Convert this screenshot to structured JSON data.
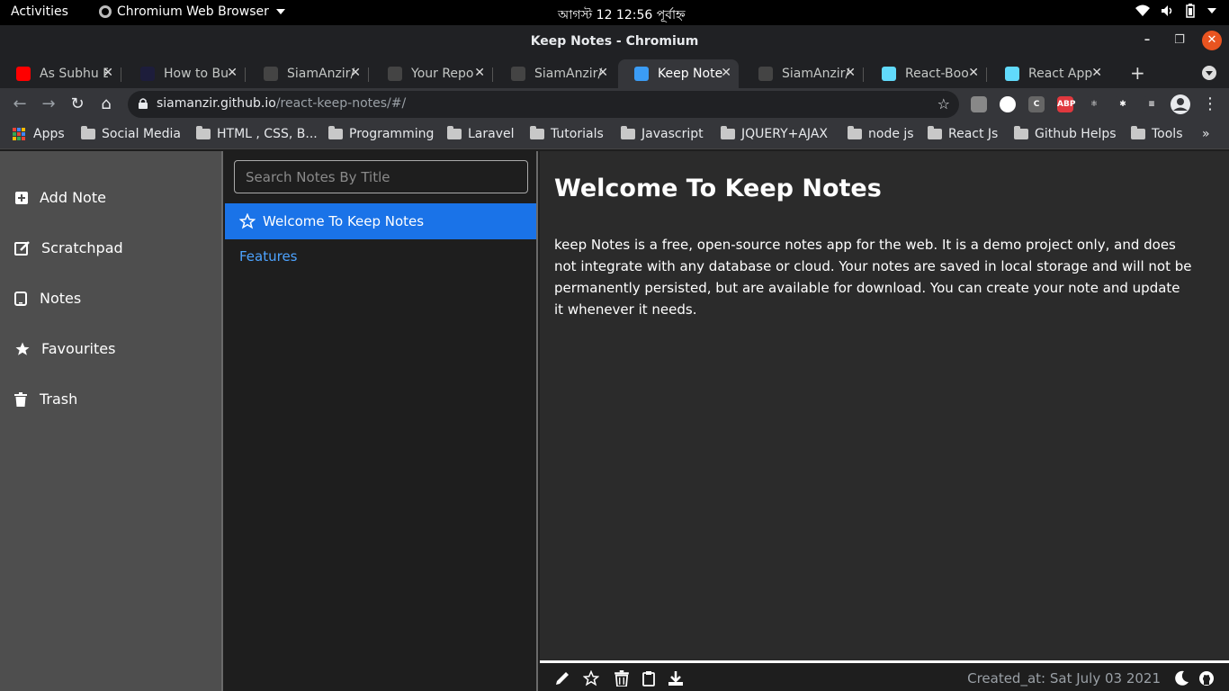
{
  "os_bar": {
    "activities": "Activities",
    "app_name": "Chromium Web Browser",
    "clock": "আগস্ট 12  12:56 পূর্বাহ্ন"
  },
  "window": {
    "title": "Keep Notes - Chromium"
  },
  "tabs": [
    {
      "label": "As Subhu E",
      "color": "#ff0000"
    },
    {
      "label": "How to Bu",
      "color": "#1d1d3b"
    },
    {
      "label": "SiamAnzir/",
      "color": "#444"
    },
    {
      "label": "Your Repo",
      "color": "#444"
    },
    {
      "label": "SiamAnzir/",
      "color": "#444"
    },
    {
      "label": "Keep Note",
      "color": "#3b9cf5"
    },
    {
      "label": "SiamAnzir/",
      "color": "#444"
    },
    {
      "label": "React-Boo",
      "color": "#61dafb"
    },
    {
      "label": "React App",
      "color": "#61dafb"
    }
  ],
  "omnibox": {
    "domain": "siamanzir.github.io",
    "path": "/react-keep-notes/#/"
  },
  "extensions": [
    {
      "name": "copy-extension-icon",
      "text": "",
      "color": "#888"
    },
    {
      "name": "dark-reader-icon",
      "text": "",
      "color": "#fff"
    },
    {
      "name": "cookie-extension-icon",
      "text": "C",
      "color": "#666"
    },
    {
      "name": "adblock-plus-icon",
      "text": "ABP",
      "color": "#e0383e"
    },
    {
      "name": "react-devtools-icon",
      "text": "⚛",
      "color": "#35363a"
    },
    {
      "name": "extensions-puzzle-icon",
      "text": "✱",
      "color": "#35363a"
    },
    {
      "name": "media-control-icon",
      "text": "≡",
      "color": "#35363a"
    }
  ],
  "bookmarks": {
    "apps_label": "Apps",
    "items": [
      "Social Media",
      "HTML , CSS, B...",
      "Programming",
      "Laravel",
      "Tutorials",
      "Javascript",
      "JQUERY+AJAX",
      "node js",
      "React Js",
      "Github Helps",
      "Tools"
    ],
    "more": "»"
  },
  "sidebar": {
    "items": [
      {
        "label": "Add Note",
        "icon": "plus-square-icon"
      },
      {
        "label": "Scratchpad",
        "icon": "edit-icon"
      },
      {
        "label": "Notes",
        "icon": "tablet-icon"
      },
      {
        "label": "Favourites",
        "icon": "star-icon"
      },
      {
        "label": "Trash",
        "icon": "trash-icon"
      }
    ]
  },
  "notelist": {
    "search_placeholder": "Search Notes By Title",
    "active_note": "Welcome To Keep Notes",
    "other_note": "Features"
  },
  "note": {
    "title": "Welcome To Keep Notes",
    "body": "keep Notes is a free, open-source notes app for the web. It is a demo project only, and does not integrate with any database or cloud. Your notes are saved in local storage and will not be permanently persisted, but are available for download. You can create your note and update it whenever it needs."
  },
  "footer": {
    "created": "Created_at: Sat July 03 2021"
  }
}
